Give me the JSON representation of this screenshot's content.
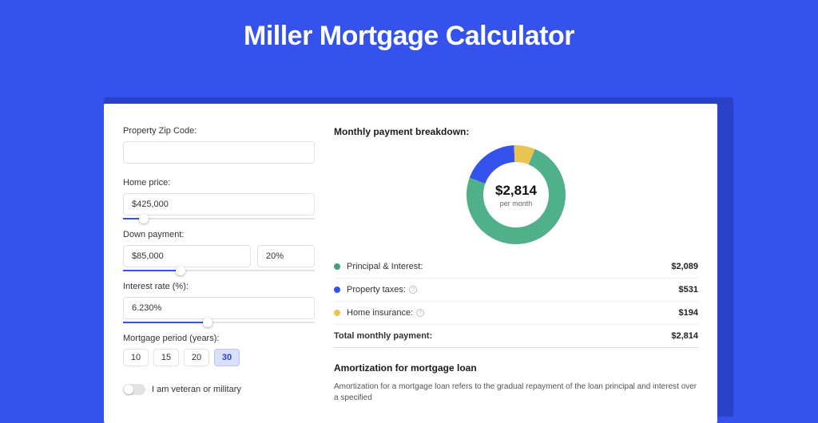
{
  "title": "Miller Mortgage Calculator",
  "form": {
    "zip": {
      "label": "Property Zip Code:",
      "value": ""
    },
    "home_price": {
      "label": "Home price:",
      "value": "$425,000",
      "slider_pct": 11
    },
    "down_payment": {
      "label": "Down payment:",
      "value": "$85,000",
      "pct_value": "20%",
      "slider_pct": 30
    },
    "interest_rate": {
      "label": "Interest rate (%):",
      "value": "6.230%",
      "slider_pct": 44
    },
    "period": {
      "label": "Mortgage period (years):",
      "options": [
        "10",
        "15",
        "20",
        "30"
      ],
      "selected": "30"
    },
    "veteran": {
      "label": "I am veteran or military",
      "on": false
    }
  },
  "breakdown": {
    "title": "Monthly payment breakdown:",
    "total_value": "$2,814",
    "total_sub": "per month",
    "items": [
      {
        "key": "pi",
        "label": "Principal & Interest:",
        "value": "$2,089",
        "color": "green",
        "info": false,
        "pct": 74.3
      },
      {
        "key": "tax",
        "label": "Property taxes:",
        "value": "$531",
        "color": "blue",
        "info": true,
        "pct": 18.8
      },
      {
        "key": "ins",
        "label": "Home insurance:",
        "value": "$194",
        "color": "yellow",
        "info": true,
        "pct": 6.9
      }
    ],
    "total_row_label": "Total monthly payment:",
    "total_row_value": "$2,814"
  },
  "amort": {
    "title": "Amortization for mortgage loan",
    "body": "Amortization for a mortgage loan refers to the gradual repayment of the loan principal and interest over a specified"
  },
  "chart_data": {
    "type": "pie",
    "title": "Monthly payment breakdown",
    "series": [
      {
        "name": "Principal & Interest",
        "value": 2089
      },
      {
        "name": "Property taxes",
        "value": 531
      },
      {
        "name": "Home insurance",
        "value": 194
      }
    ],
    "total": 2814,
    "unit": "$ per month"
  }
}
